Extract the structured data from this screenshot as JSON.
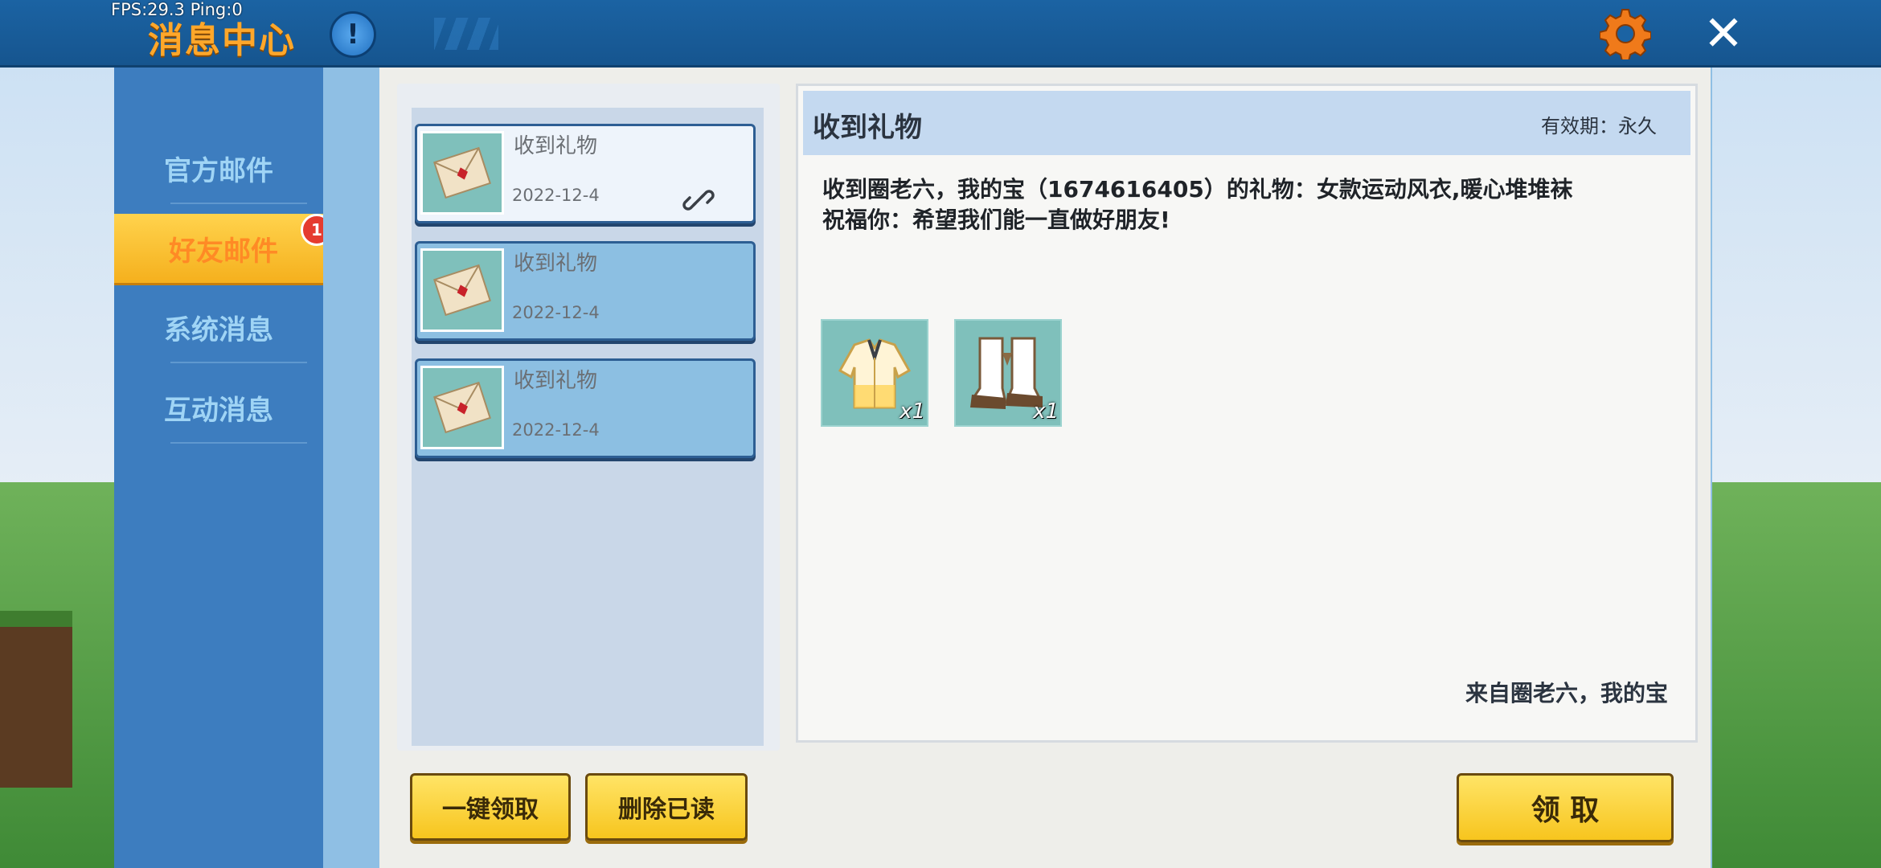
{
  "status": {
    "fps_ping": "FPS:29.3  Ping:0"
  },
  "header": {
    "title": "消息中心",
    "info_glyph": "!",
    "close_glyph": "✕"
  },
  "sidebar": {
    "items": [
      {
        "label": "官方邮件",
        "active": false
      },
      {
        "label": "好友邮件",
        "active": true,
        "badge": "1"
      },
      {
        "label": "系统消息",
        "active": false
      },
      {
        "label": "互动消息",
        "active": false
      }
    ]
  },
  "mail_list": [
    {
      "title": "收到礼物",
      "date": "2022-12-4",
      "selected": true
    },
    {
      "title": "收到礼物",
      "date": "2022-12-4",
      "selected": false
    },
    {
      "title": "收到礼物",
      "date": "2022-12-4",
      "selected": false
    }
  ],
  "buttons": {
    "claim_all": "一键领取",
    "delete_read": "删除已读",
    "claim": "领 取"
  },
  "detail": {
    "title": "收到礼物",
    "validity": "有效期：永久",
    "body_line1": "收到圈老六，我的宝（1674616405）的礼物：女款运动风衣,暖心堆堆袜",
    "body_line2": "祝福你：希望我们能一直做好朋友!",
    "gifts": [
      {
        "qty": "x1"
      },
      {
        "qty": "x1"
      }
    ],
    "sender": "来自圈老六，我的宝"
  },
  "colors": {
    "header_bg": "#1b63a3",
    "title": "#ffa72a",
    "accent_yellow": "#f7c51e",
    "sidebar_bg": "#3d7dbf",
    "gear": "#f07a1a"
  },
  "icons": {
    "info": "info-icon",
    "settings": "gear-icon",
    "close": "close-icon",
    "mail": "envelope-icon",
    "attachment": "link-icon",
    "gift_jacket": "jacket-icon",
    "gift_socks": "socks-icon"
  }
}
